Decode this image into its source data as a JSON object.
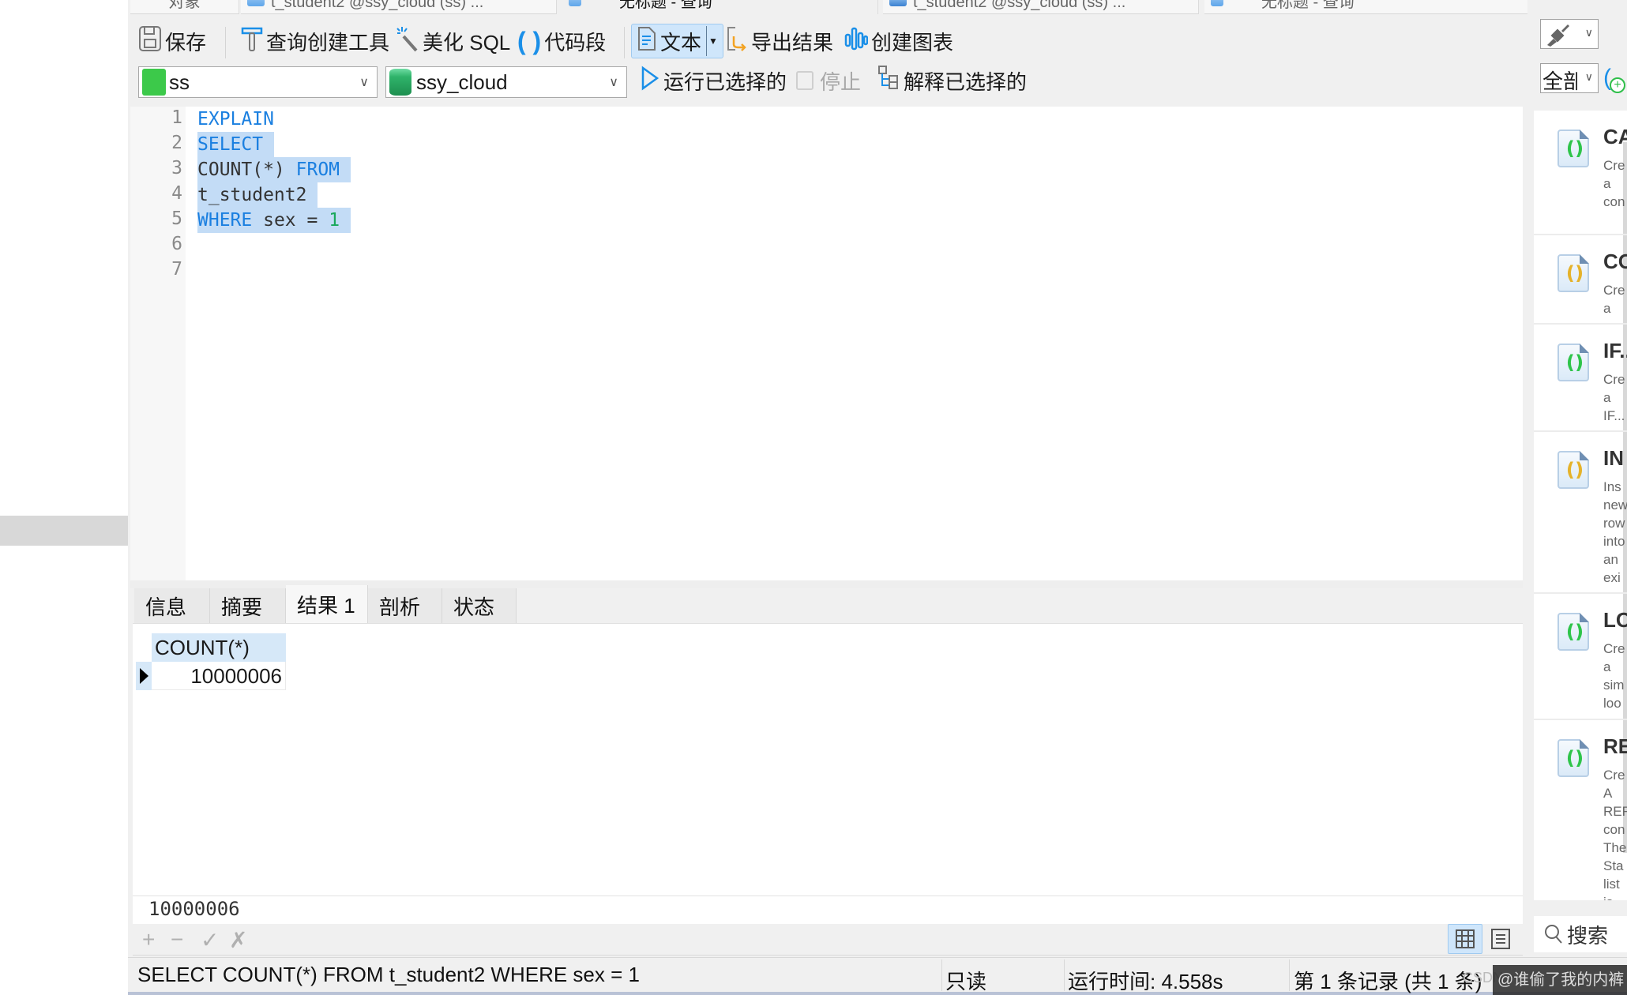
{
  "doc_tabs": [
    {
      "label": "对象"
    },
    {
      "label": "t_student2 @ssy_cloud (ss) ..."
    },
    {
      "label": "无标题 - 查询"
    },
    {
      "label": "t_student2 @ssy_cloud (ss) ..."
    },
    {
      "label": "无标题 - 查询"
    }
  ],
  "toolbar": {
    "save": "保存",
    "query_builder": "查询创建工具",
    "beautify_sql": "美化 SQL",
    "code_snippet": "代码段",
    "text": "文本",
    "export_result": "导出结果",
    "create_chart": "创建图表"
  },
  "connection": {
    "connection_value": "ss",
    "database_value": "ssy_cloud",
    "run_selected": "运行已选择的",
    "stop": "停止",
    "explain_selected": "解释已选择的"
  },
  "editor": {
    "line_numbers": [
      "1",
      "2",
      "3",
      "4",
      "5",
      "6",
      "7"
    ],
    "lines": [
      [
        {
          "t": "EXPLAIN",
          "c": "kw"
        }
      ],
      [
        {
          "t": "SELECT",
          "c": "kw"
        }
      ],
      [
        {
          "t": "COUNT(*) ",
          "c": "plain"
        },
        {
          "t": "FROM",
          "c": "kw"
        }
      ],
      [
        {
          "t": "t_student2",
          "c": "plain"
        }
      ],
      [
        {
          "t": "WHERE",
          "c": "kw"
        },
        {
          "t": " sex = ",
          "c": "plain"
        },
        {
          "t": "1",
          "c": "num"
        }
      ],
      [],
      []
    ]
  },
  "result_tabs": [
    {
      "label": "信息"
    },
    {
      "label": "摘要"
    },
    {
      "label": "结果 1",
      "active": true
    },
    {
      "label": "剖析"
    },
    {
      "label": "状态"
    }
  ],
  "result_grid": {
    "columns": [
      "COUNT(*)"
    ],
    "rows": [
      [
        "10000006"
      ]
    ]
  },
  "value_preview": "10000006",
  "grid_toolbar": {
    "add": "+",
    "remove": "−",
    "apply": "✓",
    "discard": "✗"
  },
  "statusbar": {
    "sql": "SELECT COUNT(*) FROM t_student2 WHERE sex = 1",
    "mode": "只读",
    "run_time": "运行时间: 4.558s",
    "record_info": "第 1 条记录 (共 1 条)"
  },
  "watermark": {
    "prefix": "CSDN",
    "text": "@谁偷了我的内裤"
  },
  "right_panel": {
    "filter_value": "全部",
    "snippets": [
      {
        "title": "CASE",
        "desc": [
          "Cre",
          "a",
          "con"
        ],
        "color": "#2ec44a"
      },
      {
        "title": "CO",
        "desc": [
          "Cre",
          "a"
        ],
        "color": "#e5b22a"
      },
      {
        "title": "IF...",
        "desc": [
          "Cre",
          "a",
          "IF..."
        ],
        "color": "#2ec44a"
      },
      {
        "title": "IN",
        "desc": [
          "Ins",
          "new",
          "row",
          "into",
          "an",
          "exi"
        ],
        "color": "#e5b22a"
      },
      {
        "title": "LO",
        "desc": [
          "Cre",
          "a",
          "sim",
          "loo"
        ],
        "color": "#2ec44a"
      },
      {
        "title": "RE",
        "desc": [
          "Cre",
          "A",
          "REF",
          "con",
          "The",
          "Sta",
          "list",
          "is"
        ],
        "color": "#2ec44a"
      }
    ],
    "search_label": "搜索"
  }
}
